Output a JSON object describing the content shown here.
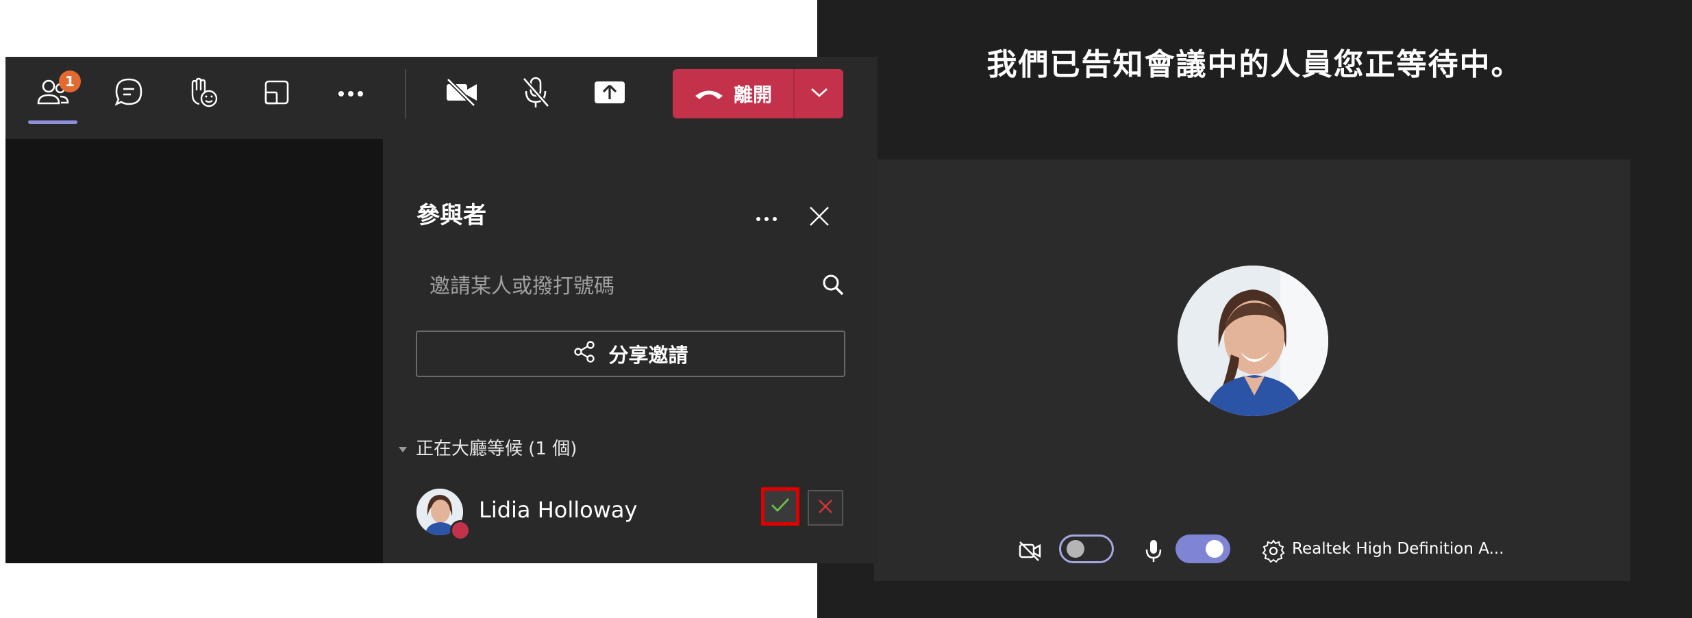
{
  "toolbar": {
    "people_badge_count": "1",
    "leave_label": "離開",
    "icons": [
      "people-icon",
      "chat-icon",
      "raise-hand-icon",
      "room-view-icon",
      "more-icon",
      "camera-off-icon",
      "mic-off-icon",
      "share-screen-icon",
      "phone-hangup-icon",
      "chevron-down-icon"
    ],
    "leave_color": "#c4314b",
    "active_indicator_color": "#8e8fdb"
  },
  "participants_pane": {
    "title": "參與者",
    "invite_placeholder": "邀請某人或撥打號碼",
    "share_invite_label": "分享邀請",
    "lobby_section": {
      "header": "正在大廳等候 (1 個)",
      "people": [
        {
          "name": "Lidia Holloway"
        }
      ]
    }
  },
  "lobby_screen": {
    "message": "我們已告知會議中的人員您正等待中。",
    "camera_on": false,
    "mic_on": true,
    "audio_device": "Realtek High Definition A..."
  },
  "colors": {
    "background_dark": "#1f1f1f",
    "panel": "#292929",
    "accent": "#7f85d4",
    "highlight_box": "#e00000"
  }
}
